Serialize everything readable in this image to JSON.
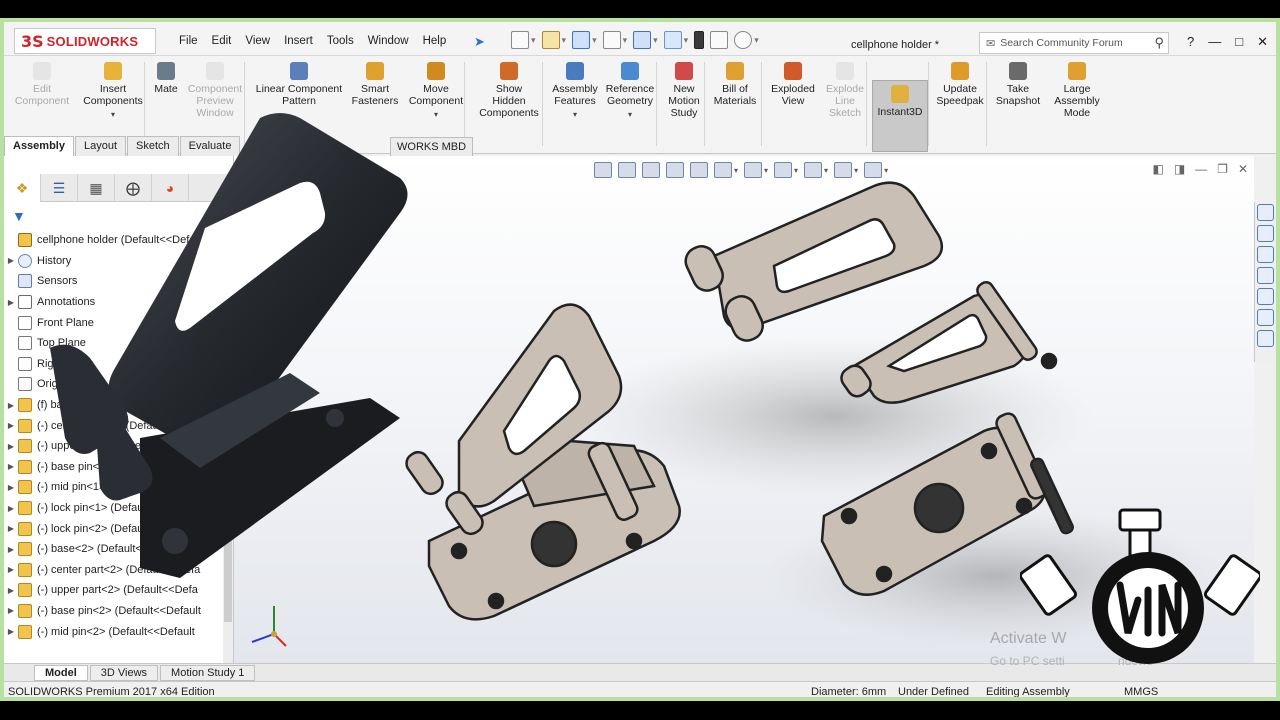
{
  "app": {
    "brand": "SOLIDWORKS",
    "brand_mark": "3S",
    "document_title": "cellphone holder *"
  },
  "menu": [
    "File",
    "Edit",
    "View",
    "Insert",
    "Tools",
    "Window",
    "Help"
  ],
  "search": {
    "placeholder": "Search Community Forum"
  },
  "ribbon": [
    {
      "label": "Edit\nComponent",
      "disabled": true
    },
    {
      "label": "Insert\nComponents",
      "disabled": false
    },
    {
      "label": "Mate",
      "disabled": false
    },
    {
      "label": "Component\nPreview\nWindow",
      "disabled": true
    },
    {
      "label": "Linear Component\nPattern",
      "disabled": false
    },
    {
      "label": "Smart\nFasteners",
      "disabled": false
    },
    {
      "label": "Move\nComponent",
      "disabled": false
    },
    {
      "label": "Show\nHidden\nComponents",
      "disabled": false
    },
    {
      "label": "Assembly\nFeatures",
      "disabled": false
    },
    {
      "label": "Reference\nGeometry",
      "disabled": false
    },
    {
      "label": "New\nMotion\nStudy",
      "disabled": false
    },
    {
      "label": "Bill of\nMaterials",
      "disabled": false
    },
    {
      "label": "Exploded\nView",
      "disabled": false
    },
    {
      "label": "Explode\nLine\nSketch",
      "disabled": true
    },
    {
      "label": "Instant3D",
      "disabled": false,
      "active": true
    },
    {
      "label": "Update\nSpeedpak",
      "disabled": false
    },
    {
      "label": "Take\nSnapshot",
      "disabled": false
    },
    {
      "label": "Large\nAssembly\nMode",
      "disabled": false
    }
  ],
  "command_tabs": [
    "Assembly",
    "Layout",
    "Sketch",
    "Evaluate"
  ],
  "command_tab_mbd": "WORKS MBD",
  "tree": [
    {
      "label": "cellphone holder  (Default<<Default>_Disp",
      "icon": "asm",
      "arrow": ""
    },
    {
      "label": "History",
      "icon": "hist",
      "arrow": "▶"
    },
    {
      "label": "Sensors",
      "icon": "sens",
      "arrow": ""
    },
    {
      "label": "Annotations",
      "icon": "ann",
      "arrow": "▶"
    },
    {
      "label": "Front Plane",
      "icon": "plane",
      "arrow": ""
    },
    {
      "label": "Top Plane",
      "icon": "plane",
      "arrow": ""
    },
    {
      "label": "Right Plane",
      "icon": "plane",
      "arrow": ""
    },
    {
      "label": "Origin",
      "icon": "plane",
      "arrow": ""
    },
    {
      "label": "(f) base<1> (Default<<Default>_Dis",
      "icon": "part",
      "arrow": "▶"
    },
    {
      "label": "(-) center part<1> (Default<<Defa",
      "icon": "part",
      "arrow": "▶"
    },
    {
      "label": "(-) upper part<1> (Default<<Defa",
      "icon": "part",
      "arrow": "▶"
    },
    {
      "label": "(-) base pin<1> (Default<<Default",
      "icon": "part",
      "arrow": "▶"
    },
    {
      "label": "(-) mid pin<1> (Default<<Default",
      "icon": "part",
      "arrow": "▶"
    },
    {
      "label": "(-) lock pin<1> (Default<<Default",
      "icon": "part",
      "arrow": "▶"
    },
    {
      "label": "(-) lock pin<2> (Default<<Default",
      "icon": "part",
      "arrow": "▶"
    },
    {
      "label": "(-) base<2> (Default<<Default>_Dis",
      "icon": "part",
      "arrow": "▶"
    },
    {
      "label": "(-) center part<2> (Default<<Defa",
      "icon": "part",
      "arrow": "▶"
    },
    {
      "label": "(-) upper part<2> (Default<<Defa",
      "icon": "part",
      "arrow": "▶"
    },
    {
      "label": "(-) base pin<2> (Default<<Default",
      "icon": "part",
      "arrow": "▶"
    },
    {
      "label": "(-) mid pin<2> (Default<<Default",
      "icon": "part",
      "arrow": "▶"
    }
  ],
  "bottom_tabs": [
    "Model",
    "3D Views",
    "Motion Study 1"
  ],
  "status": {
    "edition": "SOLIDWORKS Premium 2017 x64 Edition",
    "diameter": "Diameter: 6mm",
    "defined": "Under Defined",
    "mode": "Editing Assembly",
    "units": "MMGS"
  },
  "watermark": {
    "line1": "Activate W",
    "line2": "Go to PC setti",
    "line3": "ndows"
  },
  "colors": {
    "brand": "#d2232a",
    "frame": "#b8e0a0",
    "part_grey": "#c9bfb4",
    "part_edge": "#2a2a2a"
  }
}
